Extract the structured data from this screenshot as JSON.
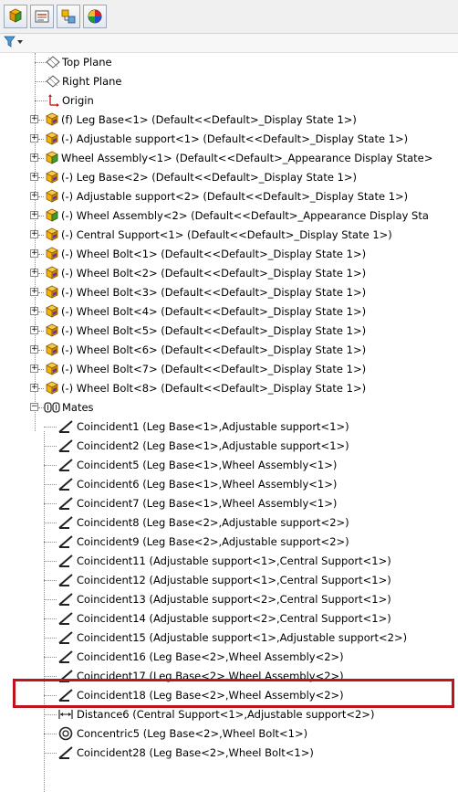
{
  "toolbar": {
    "buttons": [
      {
        "name": "feature-manager-tab-icon"
      },
      {
        "name": "property-manager-tab-icon"
      },
      {
        "name": "configuration-manager-tab-icon"
      },
      {
        "name": "display-manager-tab-icon"
      }
    ],
    "filter_icon": "filter-icon"
  },
  "tree": {
    "planes": [
      {
        "label": "Top Plane",
        "icon": "plane-icon"
      },
      {
        "label": "Right Plane",
        "icon": "plane-icon"
      },
      {
        "label": "Origin",
        "icon": "origin-icon"
      }
    ],
    "components": [
      {
        "label": "(f) Leg Base<1> (Default<<Default>_Display State 1>)",
        "icon": "part-icon"
      },
      {
        "label": "(-) Adjustable support<1> (Default<<Default>_Display State 1>)",
        "icon": "part-icon"
      },
      {
        "label": "Wheel Assembly<1> (Default<<Default>_Appearance Display State>",
        "icon": "assembly-icon"
      },
      {
        "label": "(-) Leg Base<2> (Default<<Default>_Display State 1>)",
        "icon": "part-icon"
      },
      {
        "label": "(-) Adjustable support<2> (Default<<Default>_Display State 1>)",
        "icon": "part-icon"
      },
      {
        "label": "(-) Wheel Assembly<2> (Default<<Default>_Appearance Display Sta",
        "icon": "assembly-icon"
      },
      {
        "label": "(-) Central Support<1> (Default<<Default>_Display State 1>)",
        "icon": "part-icon"
      },
      {
        "label": "(-) Wheel Bolt<1> (Default<<Default>_Display State 1>)",
        "icon": "part-icon"
      },
      {
        "label": "(-) Wheel Bolt<2> (Default<<Default>_Display State 1>)",
        "icon": "part-icon"
      },
      {
        "label": "(-) Wheel Bolt<3> (Default<<Default>_Display State 1>)",
        "icon": "part-icon"
      },
      {
        "label": "(-) Wheel Bolt<4> (Default<<Default>_Display State 1>)",
        "icon": "part-icon"
      },
      {
        "label": "(-) Wheel Bolt<5> (Default<<Default>_Display State 1>)",
        "icon": "part-icon"
      },
      {
        "label": "(-) Wheel Bolt<6> (Default<<Default>_Display State 1>)",
        "icon": "part-icon"
      },
      {
        "label": "(-) Wheel Bolt<7> (Default<<Default>_Display State 1>)",
        "icon": "part-icon"
      },
      {
        "label": "(-) Wheel Bolt<8> (Default<<Default>_Display State 1>)",
        "icon": "part-icon"
      }
    ],
    "mates_folder": {
      "label": "Mates",
      "icon": "mates-folder-icon"
    },
    "mates": [
      {
        "label": "Coincident1 (Leg Base<1>,Adjustable support<1>)",
        "icon": "coincident-mate-icon"
      },
      {
        "label": "Coincident2 (Leg Base<1>,Adjustable support<1>)",
        "icon": "coincident-mate-icon"
      },
      {
        "label": "Coincident5 (Leg Base<1>,Wheel Assembly<1>)",
        "icon": "coincident-mate-icon"
      },
      {
        "label": "Coincident6 (Leg Base<1>,Wheel Assembly<1>)",
        "icon": "coincident-mate-icon"
      },
      {
        "label": "Coincident7 (Leg Base<1>,Wheel Assembly<1>)",
        "icon": "coincident-mate-icon"
      },
      {
        "label": "Coincident8 (Leg Base<2>,Adjustable support<2>)",
        "icon": "coincident-mate-icon"
      },
      {
        "label": "Coincident9 (Leg Base<2>,Adjustable support<2>)",
        "icon": "coincident-mate-icon"
      },
      {
        "label": "Coincident11 (Adjustable support<1>,Central Support<1>)",
        "icon": "coincident-mate-icon"
      },
      {
        "label": "Coincident12 (Adjustable support<1>,Central Support<1>)",
        "icon": "coincident-mate-icon"
      },
      {
        "label": "Coincident13 (Adjustable support<2>,Central Support<1>)",
        "icon": "coincident-mate-icon"
      },
      {
        "label": "Coincident14 (Adjustable support<2>,Central Support<1>)",
        "icon": "coincident-mate-icon"
      },
      {
        "label": "Coincident15 (Adjustable support<1>,Adjustable support<2>)",
        "icon": "coincident-mate-icon"
      },
      {
        "label": "Coincident16 (Leg Base<2>,Wheel Assembly<2>)",
        "icon": "coincident-mate-icon"
      },
      {
        "label": "Coincident17 (Leg Base<2>,Wheel Assembly<2>)",
        "icon": "coincident-mate-icon"
      },
      {
        "label": "Coincident18 (Leg Base<2>,Wheel Assembly<2>)",
        "icon": "coincident-mate-icon"
      },
      {
        "label": "Distance6 (Central Support<1>,Adjustable support<2>)",
        "icon": "distance-mate-icon"
      },
      {
        "label": "Concentric5 (Leg Base<2>,Wheel Bolt<1>)",
        "icon": "concentric-mate-icon"
      },
      {
        "label": "Coincident28 (Leg Base<2>,Wheel Bolt<1>)",
        "icon": "coincident-mate-icon"
      }
    ]
  },
  "colors": {
    "highlight_border": "#c0141c",
    "part_yellow": "#f2b400",
    "assembly_green": "#3f9b2f"
  }
}
